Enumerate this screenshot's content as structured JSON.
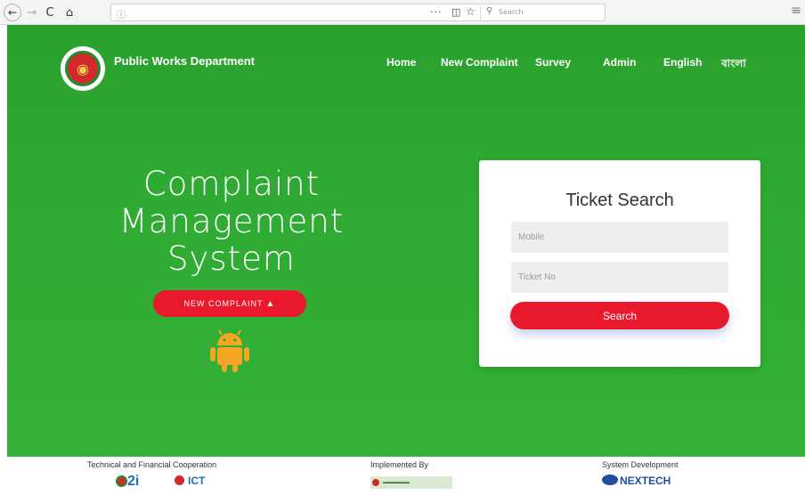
{
  "browser": {
    "search_placeholder": "Search",
    "dots": "···",
    "back": "←",
    "forward": "→",
    "reload": "C",
    "home": "⌂",
    "info": "ⓘ",
    "menu": "≡"
  },
  "header": {
    "brand": "Public Works Department",
    "menu": [
      "Home",
      "New Complaint",
      "Survey",
      "Admin",
      "English",
      "বাংলা"
    ]
  },
  "hero": {
    "title_lines": [
      "Complaint",
      "Management",
      "System"
    ],
    "new_complaint_label": "NEW COMPLAINT",
    "android_icon": "android-icon"
  },
  "ticket_search": {
    "title": "Ticket Search",
    "mobile_placeholder": "Mobile",
    "ticket_placeholder": "Ticket No",
    "search_label": "Search"
  },
  "footer": {
    "cooperation_label": "Technical and Financial Cooperation",
    "implemented_label": "Implemented By",
    "development_label": "System Development",
    "a2i_text": "2i",
    "ict_text": "ICT",
    "nextech_text": "NEXTECH"
  },
  "colors": {
    "hero_green": "#2faa33",
    "accent_red": "#e8192c"
  }
}
